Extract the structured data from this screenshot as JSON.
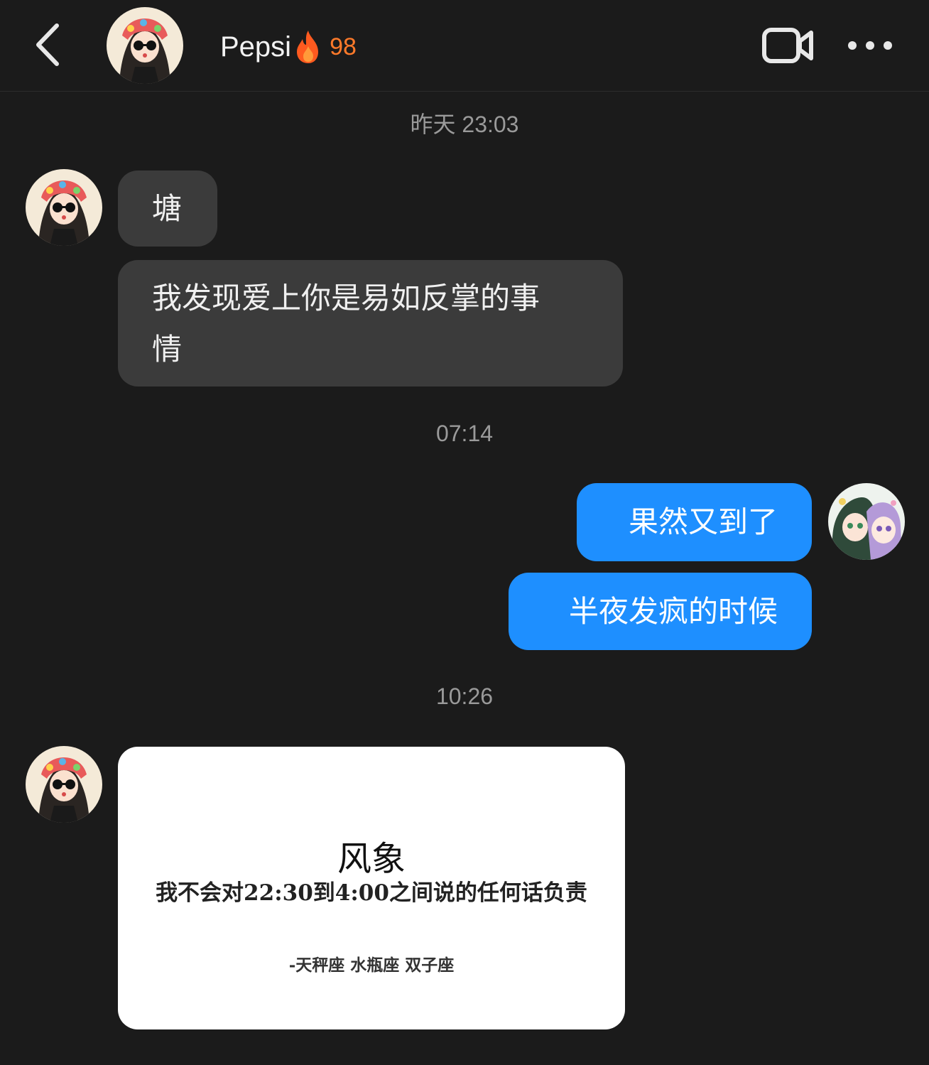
{
  "header": {
    "title": "Pepsi",
    "streak_count": "98",
    "back_icon": "chevron-left-icon",
    "flame_icon": "flame-icon",
    "video_icon": "video-camera-icon",
    "more_icon": "more-dots-icon"
  },
  "colors": {
    "background": "#1b1b1b",
    "incoming_bubble": "#3b3b3b",
    "outgoing_bubble": "#1e8fff",
    "streak": "#ff7a2a"
  },
  "messages": {
    "ts1": "昨天 23:03",
    "m1": "塘",
    "m2": "我发现爱上你是易如反掌的事\n情",
    "ts2": "07:14",
    "m3": "果然又到了",
    "m4": "半夜发疯的时候",
    "ts3": "10:26",
    "image_card": {
      "title": "风象",
      "quote": "我不会对22:30到4:00之间说的任何话负责",
      "signature": "-天秤座  水瓶座  双子座"
    }
  }
}
